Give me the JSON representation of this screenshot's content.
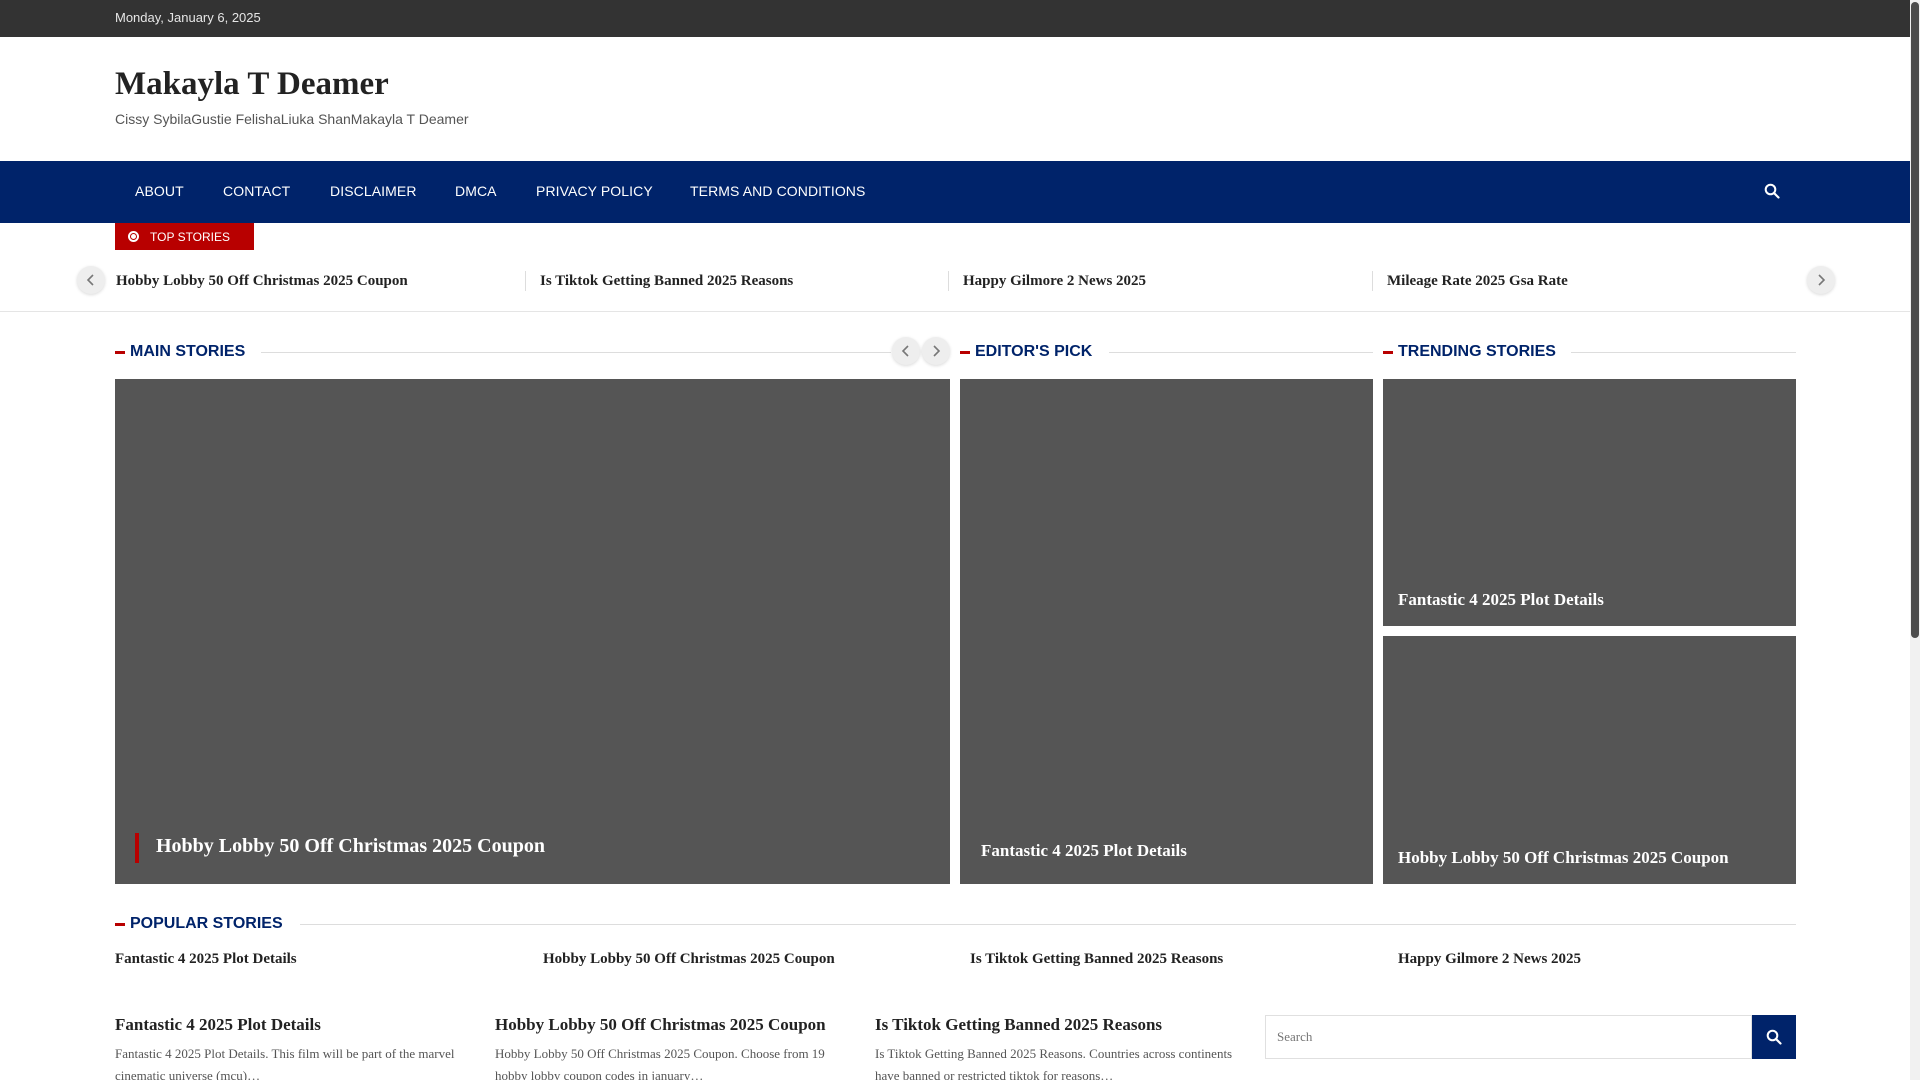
{
  "topbar": {
    "date": "Monday, January 6, 2025"
  },
  "site": {
    "title": "Makayla T Deamer",
    "tagline": "Cissy SybilaGustie FelishaLiuka ShanMakayla T Deamer"
  },
  "nav": {
    "items": [
      "ABOUT",
      "CONTACT",
      "DISCLAIMER",
      "DMCA",
      "PRIVACY POLICY",
      "TERMS AND CONDITIONS"
    ],
    "search_icon": "search-icon"
  },
  "top_stories": {
    "label": "TOP STORIES",
    "items": [
      "Hobby Lobby 50 Off Christmas 2025 Coupon",
      "Is Tiktok Getting Banned 2025 Reasons",
      "Happy Gilmore 2 News 2025",
      "Mileage Rate 2025 Gsa Rate"
    ]
  },
  "main_stories": {
    "heading": "MAIN STORIES",
    "feature_title": "Hobby Lobby 50 Off Christmas 2025 Coupon"
  },
  "editors_pick": {
    "heading": "EDITOR'S PICK",
    "title": "Fantastic 4 2025 Plot Details"
  },
  "trending": {
    "heading": "TRENDING STORIES",
    "items": [
      "Fantastic 4 2025 Plot Details",
      "Hobby Lobby 50 Off Christmas 2025 Coupon"
    ]
  },
  "popular": {
    "heading": "POPULAR STORIES",
    "items": [
      "Fantastic 4 2025 Plot Details",
      "Hobby Lobby 50 Off Christmas 2025 Coupon",
      "Is Tiktok Getting Banned 2025 Reasons",
      "Happy Gilmore 2 News 2025"
    ]
  },
  "posts": [
    {
      "title": "Fantastic 4 2025 Plot Details",
      "excerpt": "Fantastic 4 2025 Plot Details. This film will be part of the marvel cinematic universe (mcu)…"
    },
    {
      "title": "Hobby Lobby 50 Off Christmas 2025 Coupon",
      "excerpt": "Hobby Lobby 50 Off Christmas 2025 Coupon. Choose from 19 hobby lobby coupon codes in january…"
    },
    {
      "title": "Is Tiktok Getting Banned 2025 Reasons",
      "excerpt": "Is Tiktok Getting Banned 2025 Reasons. Countries across continents have banned or restricted tiktok for reasons…"
    }
  ],
  "sidebar_search": {
    "placeholder": "Search"
  },
  "colors": {
    "nav": "#00236a",
    "accent": "#b80000",
    "topbar": "#333333",
    "card": "#555555"
  }
}
